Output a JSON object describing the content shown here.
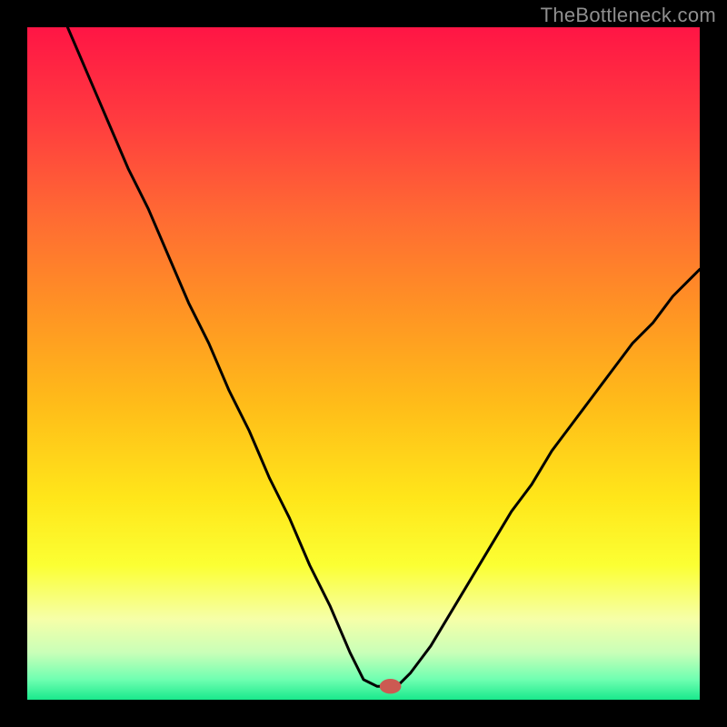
{
  "watermark": "TheBottleneck.com",
  "colors": {
    "frame_bg": "#000000",
    "gradient_stops": [
      {
        "offset": 0.0,
        "color": "#ff1545"
      },
      {
        "offset": 0.14,
        "color": "#ff3c3f"
      },
      {
        "offset": 0.28,
        "color": "#ff6a33"
      },
      {
        "offset": 0.42,
        "color": "#ff9324"
      },
      {
        "offset": 0.56,
        "color": "#ffbc19"
      },
      {
        "offset": 0.7,
        "color": "#ffe61a"
      },
      {
        "offset": 0.8,
        "color": "#fbff33"
      },
      {
        "offset": 0.88,
        "color": "#f6ffa8"
      },
      {
        "offset": 0.93,
        "color": "#c9ffb8"
      },
      {
        "offset": 0.97,
        "color": "#6fffb1"
      },
      {
        "offset": 1.0,
        "color": "#19e98c"
      }
    ],
    "curve_stroke": "#000000",
    "marker_fill": "#cc5a52"
  },
  "chart_data": {
    "type": "line",
    "title": "",
    "xlabel": "",
    "ylabel": "",
    "xlim": [
      0,
      100
    ],
    "ylim": [
      0,
      100
    ],
    "marker": {
      "x": 54,
      "y": 2,
      "rx": 1.6,
      "ry": 1.1
    },
    "series": [
      {
        "name": "bottleneck-curve",
        "points": [
          {
            "x": 6,
            "y": 100
          },
          {
            "x": 9,
            "y": 93
          },
          {
            "x": 12,
            "y": 86
          },
          {
            "x": 15,
            "y": 79
          },
          {
            "x": 18,
            "y": 73
          },
          {
            "x": 21,
            "y": 66
          },
          {
            "x": 24,
            "y": 59
          },
          {
            "x": 27,
            "y": 53
          },
          {
            "x": 30,
            "y": 46
          },
          {
            "x": 33,
            "y": 40
          },
          {
            "x": 36,
            "y": 33
          },
          {
            "x": 39,
            "y": 27
          },
          {
            "x": 42,
            "y": 20
          },
          {
            "x": 45,
            "y": 14
          },
          {
            "x": 48,
            "y": 7
          },
          {
            "x": 50,
            "y": 3
          },
          {
            "x": 52,
            "y": 2
          },
          {
            "x": 55,
            "y": 2
          },
          {
            "x": 57,
            "y": 4
          },
          {
            "x": 60,
            "y": 8
          },
          {
            "x": 63,
            "y": 13
          },
          {
            "x": 66,
            "y": 18
          },
          {
            "x": 69,
            "y": 23
          },
          {
            "x": 72,
            "y": 28
          },
          {
            "x": 75,
            "y": 32
          },
          {
            "x": 78,
            "y": 37
          },
          {
            "x": 81,
            "y": 41
          },
          {
            "x": 84,
            "y": 45
          },
          {
            "x": 87,
            "y": 49
          },
          {
            "x": 90,
            "y": 53
          },
          {
            "x": 93,
            "y": 56
          },
          {
            "x": 96,
            "y": 60
          },
          {
            "x": 100,
            "y": 64
          }
        ]
      }
    ]
  }
}
